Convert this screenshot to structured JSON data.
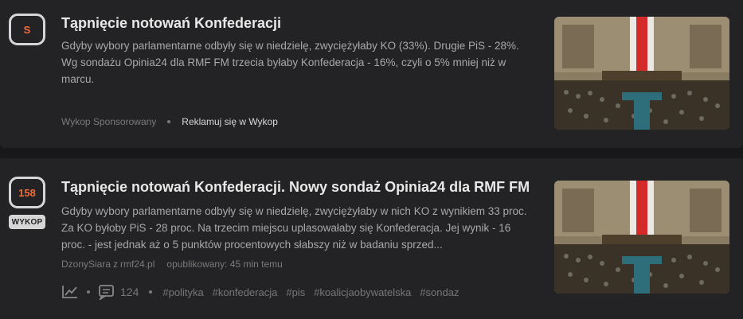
{
  "posts": [
    {
      "vote_label": "S",
      "title": "Tąpnięcie notowań Konfederacji",
      "description": "Gdyby wybory parlamentarne odbyły się w niedzielę, zwyciężyłaby KO (33%). Drugie PiS - 28%. Wg sondażu Opinia24 dla RMF FM trzecia byłaby Konfederacja - 16%, czyli o 5% mniej niż w marcu.",
      "sponsor_label": "Wykop Sponsorowany",
      "advertise_link": "Reklamuj się w Wykop"
    },
    {
      "vote_count": "158",
      "vote_button": "WYKOP",
      "title": "Tąpnięcie notowań Konfederacji. Nowy sondaż Opinia24 dla RMF FM",
      "description": "Gdyby wybory parlamentarne odbyły się w niedzielę, zwyciężyłaby w nich KO z wynikiem 33 proc. Za KO byłoby PiS - 28 proc. Na trzecim miejscu uplasowałaby się Konfederacja. Jej wynik - 16 proc. - jest jednak aż o 5 punktów procentowych słabszy niż w badaniu sprzed...",
      "author": "DzonySiara",
      "source_prefix": "z",
      "source": "rmf24.pl",
      "published": "opublikowany: 45 min temu",
      "comments_count": "124",
      "tags": [
        "#polityka",
        "#konfederacja",
        "#pis",
        "#koalicjaobywatelska",
        "#sondaz"
      ]
    }
  ],
  "colors": {
    "accent": "#f26c3a",
    "background": "#18181a",
    "card": "#232325"
  },
  "icons": [
    "chart-icon",
    "comments-icon"
  ]
}
